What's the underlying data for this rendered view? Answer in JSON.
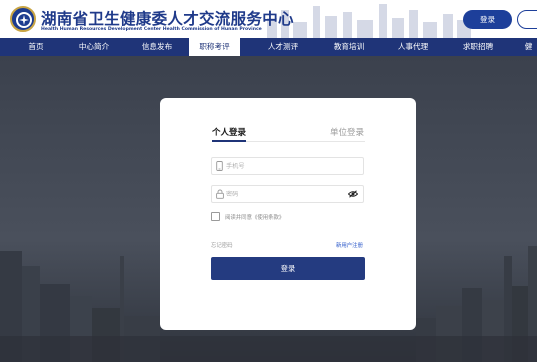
{
  "header": {
    "title_cn": "湖南省卫生健康委人才交流服务中心",
    "title_en": "Health Human Resources Development Center Health Commission of Hunan Province",
    "login_label": "登录"
  },
  "nav": {
    "items": [
      {
        "label": "首页",
        "active": false
      },
      {
        "label": "中心简介",
        "active": false
      },
      {
        "label": "信息发布",
        "active": false
      },
      {
        "label": "职称考评",
        "active": true
      },
      {
        "label": "人才测评",
        "active": false
      },
      {
        "label": "教育培训",
        "active": false
      },
      {
        "label": "人事代理",
        "active": false
      },
      {
        "label": "求职招聘",
        "active": false
      },
      {
        "label": "健",
        "active": false
      }
    ]
  },
  "login": {
    "tab_personal": "个人登录",
    "tab_unit": "单位登录",
    "phone_placeholder": "手机号",
    "password_placeholder": "密码",
    "agree_text": "阅读并同意《使用条款》",
    "forgot_label": "忘记密码",
    "register_label": "新用户注册",
    "submit_label": "登录"
  },
  "colors": {
    "brand": "#1f3478",
    "button": "#243b80",
    "link": "#2a57c9"
  }
}
